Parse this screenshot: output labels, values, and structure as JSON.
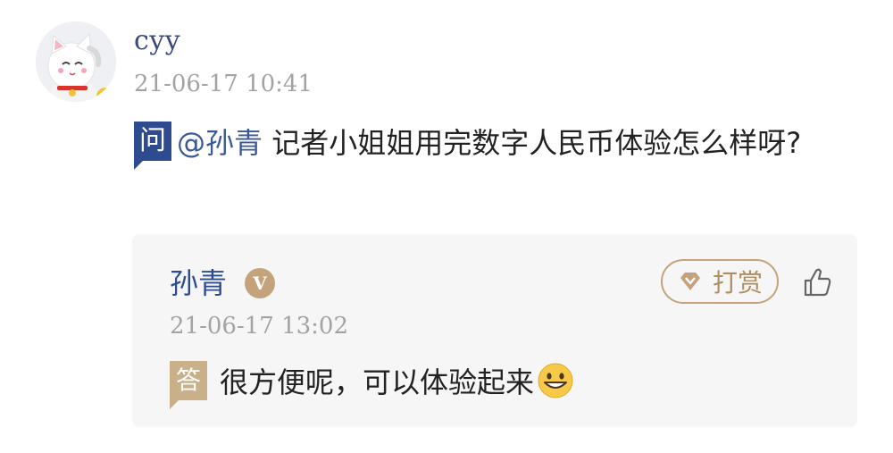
{
  "question": {
    "username": "cyy",
    "timestamp": "21-06-17 10:41",
    "badge": "问",
    "mention": "@孙青",
    "text": "记者小姐姐用完数字人民币体验怎么样呀?"
  },
  "reply": {
    "author": "孙青",
    "verified_badge": "V",
    "tip_label": "打赏",
    "timestamp": "21-06-17 13:02",
    "badge": "答",
    "text": "很方便呢，可以体验起来",
    "emoji": "grinning-face-emoji"
  },
  "colors": {
    "question_badge": "#2f4b8f",
    "answer_badge": "#c9b089",
    "gold_accent": "#c4a27a",
    "mention": "#3b5998",
    "reply_background": "#f6f6f6",
    "timestamp": "#a3a3a3"
  }
}
